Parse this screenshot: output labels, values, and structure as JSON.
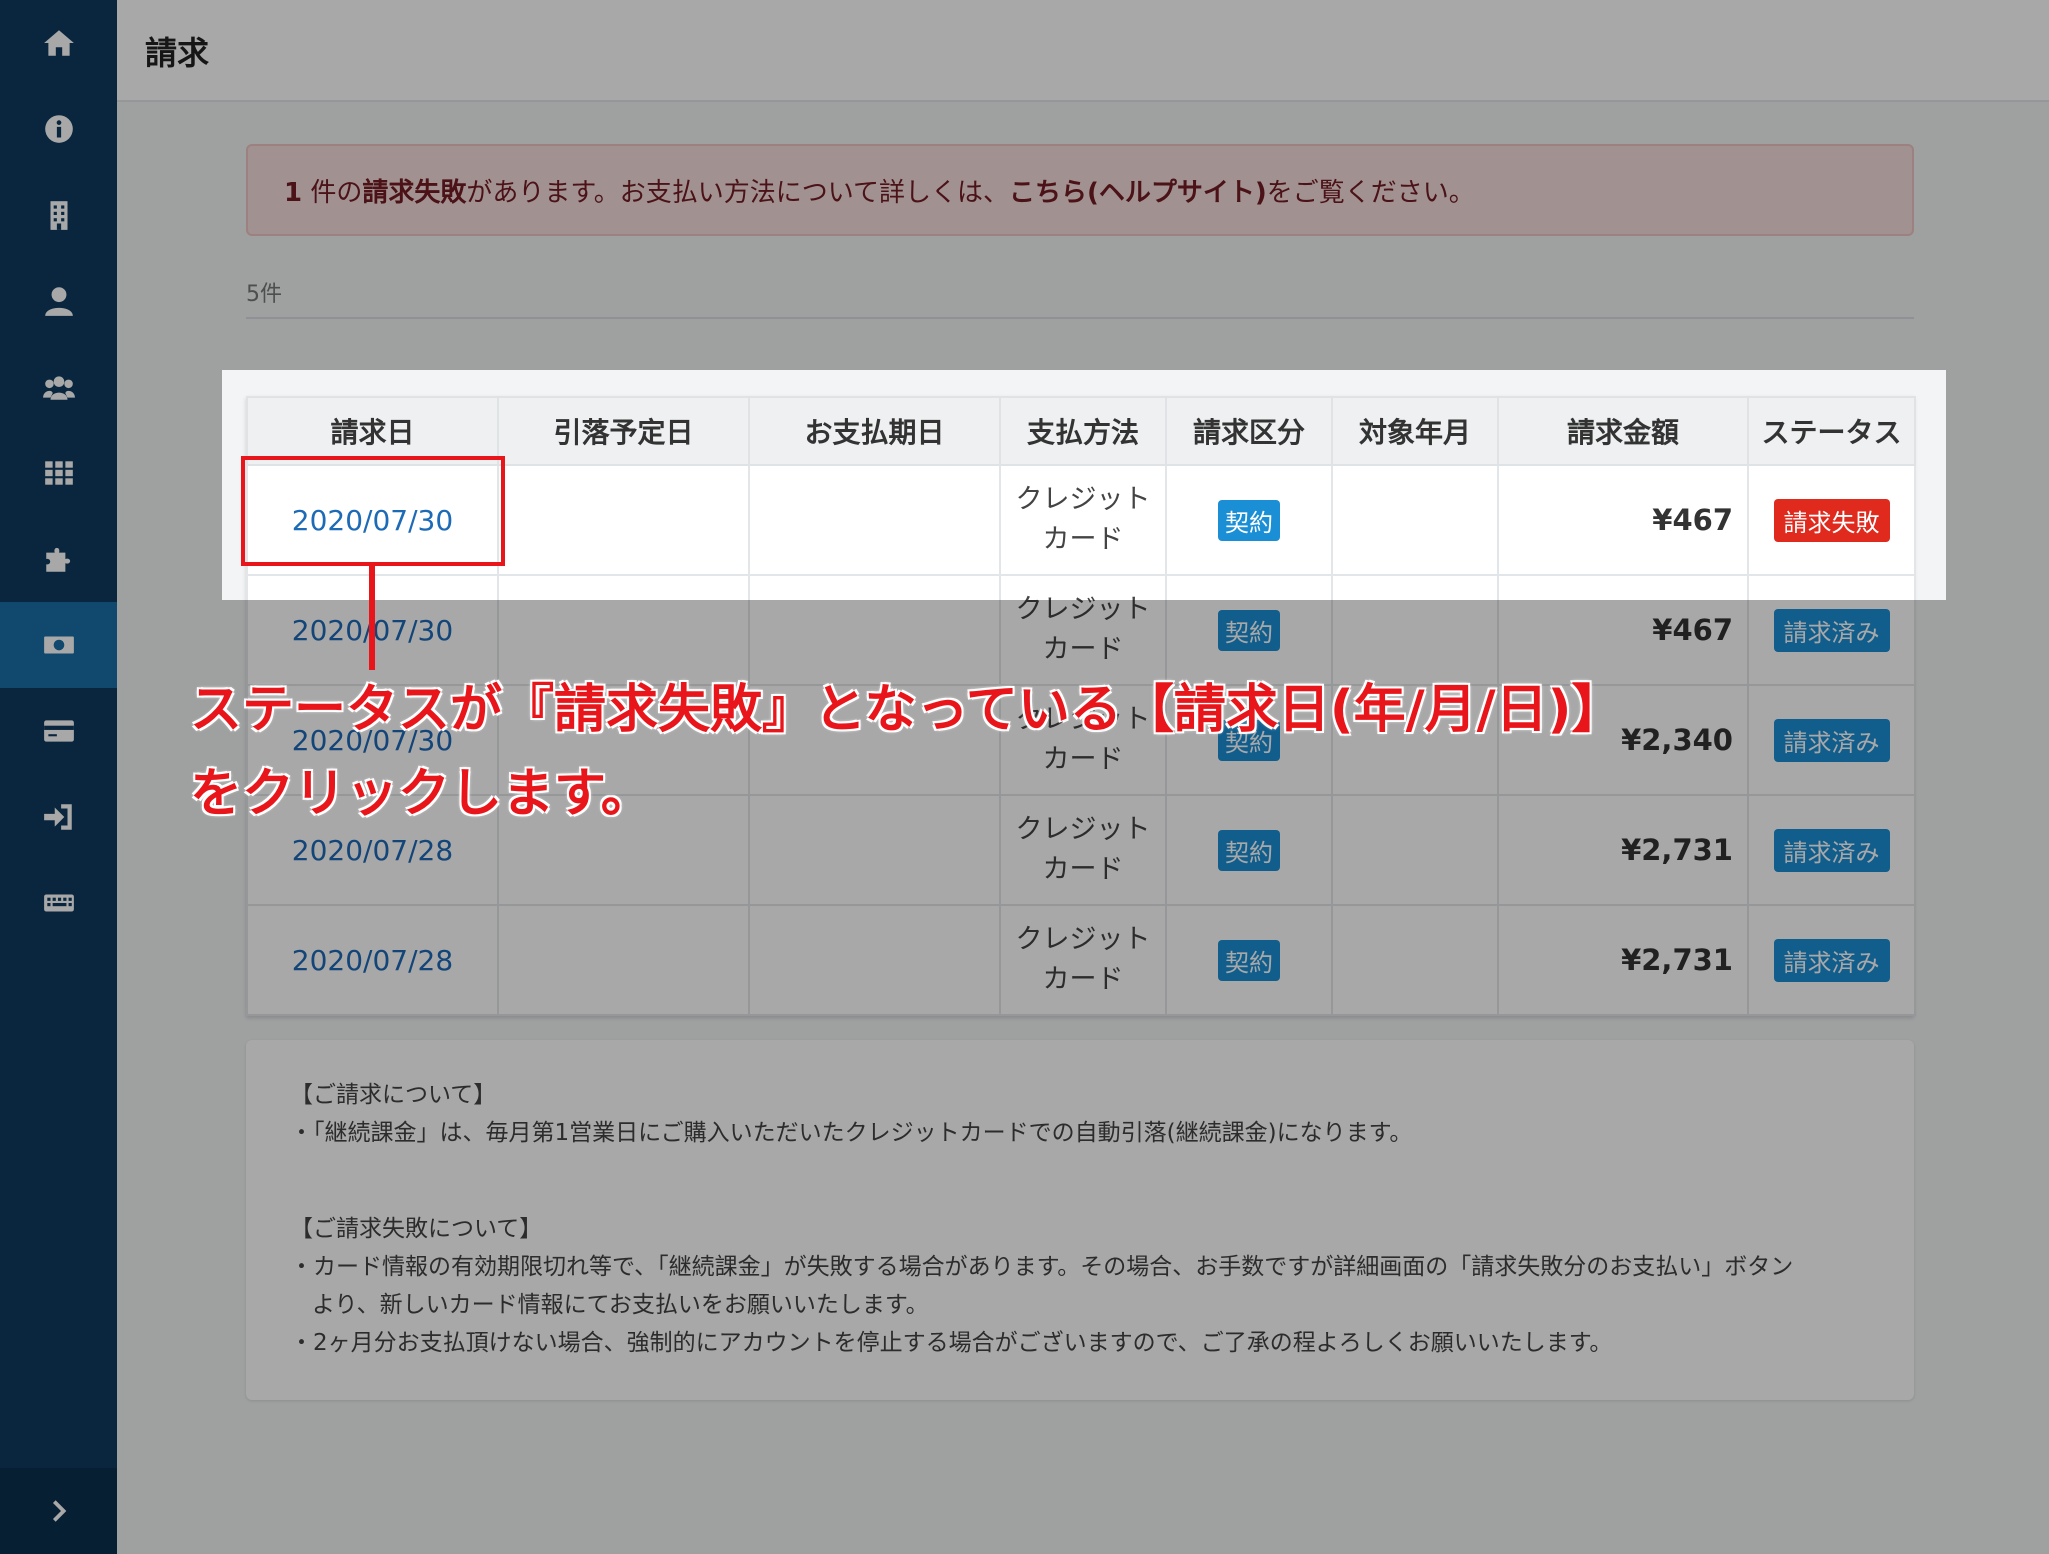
{
  "header": {
    "title": "請求"
  },
  "sidebar": {
    "items": [
      {
        "icon": "home-icon"
      },
      {
        "icon": "info-icon"
      },
      {
        "icon": "building-icon"
      },
      {
        "icon": "user-icon"
      },
      {
        "icon": "users-icon"
      },
      {
        "icon": "grid-icon"
      },
      {
        "icon": "puzzle-icon"
      },
      {
        "icon": "money-bill-icon",
        "active": true
      },
      {
        "icon": "credit-card-icon"
      },
      {
        "icon": "sign-in-icon"
      },
      {
        "icon": "keyboard-icon"
      }
    ],
    "expand_icon": "chevron-right-icon"
  },
  "alert": {
    "count": "1",
    "text1": " 件の",
    "emphasis": "請求失敗",
    "text2": "があります。お支払い方法について詳しくは、",
    "link": "こちら(ヘルプサイト)",
    "text3": "をご覧ください。"
  },
  "count_label": "5件",
  "table": {
    "headers": [
      "請求日",
      "引落予定日",
      "お支払期日",
      "支払方法",
      "請求区分",
      "対象年月",
      "請求金額",
      "ステータス"
    ],
    "rows": [
      {
        "date": "2020/07/30",
        "withdraw": "",
        "due": "",
        "method1": "クレジット",
        "method2": "カード",
        "type": "契約",
        "period": "",
        "amount": "¥467",
        "status": "請求失敗"
      },
      {
        "date": "2020/07/30",
        "withdraw": "",
        "due": "",
        "method1": "クレジット",
        "method2": "カード",
        "type": "契約",
        "period": "",
        "amount": "¥467",
        "status": "請求済み"
      },
      {
        "date": "2020/07/30",
        "withdraw": "",
        "due": "",
        "method1": "クレジット",
        "method2": "カード",
        "type": "契約",
        "period": "",
        "amount": "¥2,340",
        "status": "請求済み"
      },
      {
        "date": "2020/07/28",
        "withdraw": "",
        "due": "",
        "method1": "クレジット",
        "method2": "カード",
        "type": "契約",
        "period": "",
        "amount": "¥2,731",
        "status": "請求済み"
      },
      {
        "date": "2020/07/28",
        "withdraw": "",
        "due": "",
        "method1": "クレジット",
        "method2": "カード",
        "type": "契約",
        "period": "",
        "amount": "¥2,731",
        "status": "請求済み"
      }
    ]
  },
  "notes": {
    "heading1": "【ご請求について】",
    "line1": "・「継続課金」は、毎月第1営業日にご購入いただいたクレジットカードでの自動引落(継続課金)になります。",
    "heading2": "【ご請求失敗について】",
    "line2": "・カード情報の有効期限切れ等で、「継続課金」が失敗する場合があります。その場合、お手数ですが詳細画面の「請求失敗分のお支払い」ボタン",
    "line3": "より、新しいカード情報にてお支払いをお願いいたします。",
    "line4": "・2ヶ月分お支払頂けない場合、強制的にアカウントを停止する場合がございますので、ご了承の程よろしくお願いいたします。"
  },
  "annotation": {
    "line1": "ステータスが『請求失敗』となっている【請求日(年/月/日)】",
    "line2": "をクリックします。"
  },
  "colors": {
    "sidebar": "#0f3b5e",
    "active": "#1a6fa8",
    "link": "#1d6ab6",
    "fail": "#e02a1d",
    "badge": "#1a8fd6",
    "annotation": "#e8161b"
  }
}
